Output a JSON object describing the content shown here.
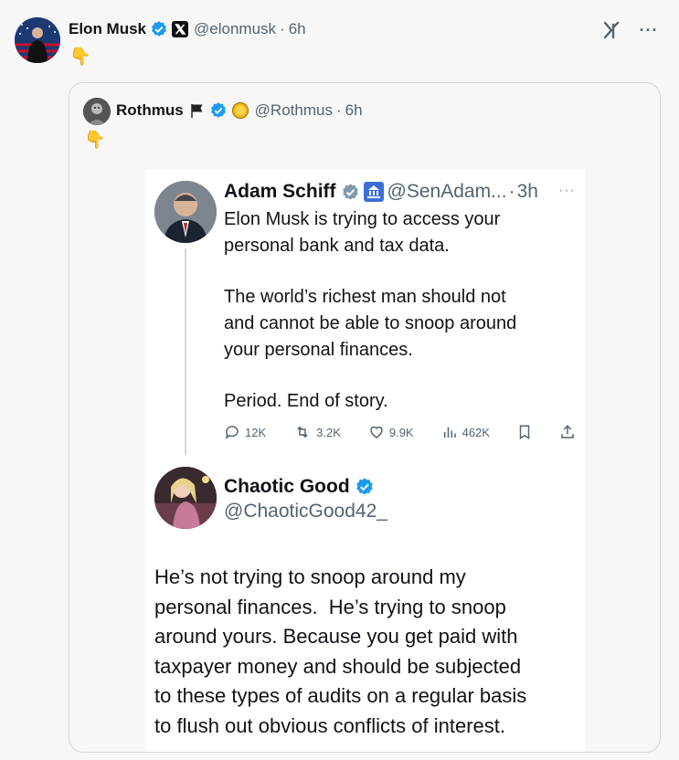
{
  "post": {
    "author_name": "Elon Musk",
    "handle": "@elonmusk",
    "separator": "·",
    "time": "6h",
    "text": "👇",
    "avatar_icon": "avatar-flag-photo",
    "verified_color": "#1d9bf0"
  },
  "toolbar": {
    "grok_icon": "grok-icon",
    "more_icon": "more-icon",
    "more_label": "···"
  },
  "quote": {
    "author_name": "Rothmus",
    "flag_emoji": "🏴",
    "affiliate_emoji": "🟡",
    "handle": "@Rothmus",
    "separator": "·",
    "time": "6h",
    "text": "👇"
  },
  "screenshot": {
    "tweet1": {
      "author_name": "Adam Schiff",
      "handle": "@SenAdam...",
      "separator": "·",
      "time": "3h",
      "more": "···",
      "line1": "Elon Musk is trying to access your",
      "line2": "personal bank and tax data.",
      "line3": "The world’s richest man should not",
      "line4": "and cannot be able to snoop around",
      "line5": "your personal finances.",
      "line6": "Period. End of story.",
      "replies": "12K",
      "reposts": "3.2K",
      "likes": "9.9K",
      "views": "462K"
    },
    "tweet2": {
      "author_name": "Chaotic Good",
      "handle": "@ChaoticGood42_",
      "line1": "He’s not trying to snoop around my",
      "line2": "personal finances.  He’s trying to snoop",
      "line3": "around yours. Because you get paid with",
      "line4": "taxpayer money and should be subjected",
      "line5": "to these types of audits on a regular basis",
      "line6": "to flush out obvious conflicts of interest."
    }
  },
  "colors": {
    "background": "#f7f7f7",
    "verified_blue": "#1d9bf0",
    "verified_gray": "#829aab",
    "muted_text": "#536471",
    "border": "#cfd9de"
  }
}
